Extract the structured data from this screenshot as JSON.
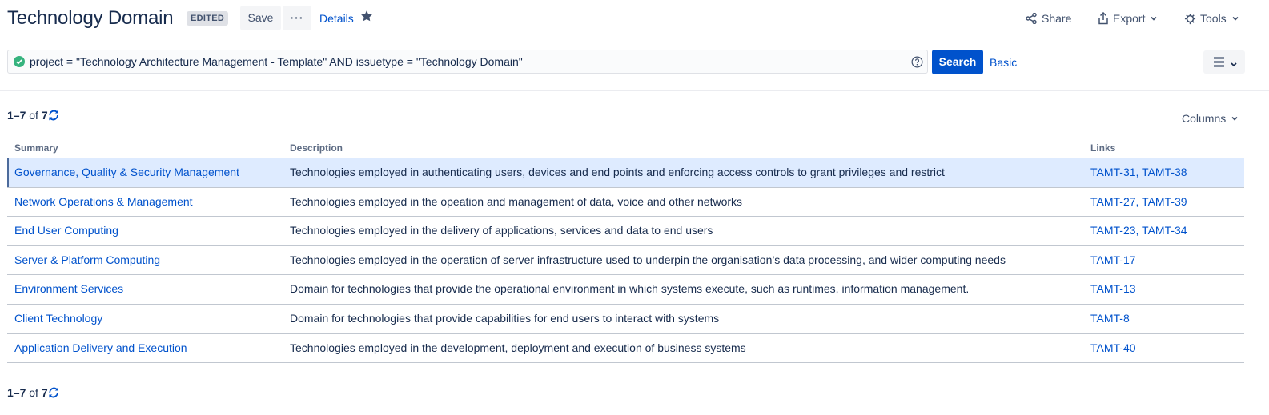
{
  "header": {
    "title": "Technology Domain",
    "badge": "EDITED",
    "save_label": "Save",
    "more_label": "···",
    "details_label": "Details",
    "share_label": "Share",
    "export_label": "Export",
    "tools_label": "Tools"
  },
  "search": {
    "query": "project = \"Technology Architecture Management - Template\" AND issuetype = \"Technology Domain\"",
    "search_label": "Search",
    "basic_label": "Basic"
  },
  "results": {
    "range": "1–7",
    "of_label": "of",
    "total": "7",
    "columns_label": "Columns",
    "headers": {
      "summary": "Summary",
      "description": "Description",
      "links": "Links"
    },
    "rows": [
      {
        "summary": "Governance, Quality & Security Management",
        "description": "Technologies employed in authenticating users, devices and end points and enforcing access controls to grant privileges and restrict",
        "links": "TAMT-31, TAMT-38"
      },
      {
        "summary": "Network Operations & Management",
        "description": "Technologies employed in the opeation and management of data, voice and other networks",
        "links": "TAMT-27, TAMT-39"
      },
      {
        "summary": "End User Computing",
        "description": "Technologies employed in the delivery of applications, services and data to end users",
        "links": "TAMT-23, TAMT-34"
      },
      {
        "summary": "Server & Platform Computing",
        "description": "Technologies employed in the operation of server infrastructure used to underpin the organisation’s data processing, and wider computing needs",
        "links": "TAMT-17"
      },
      {
        "summary": "Environment Services",
        "description": "Domain for technologies that provide the operational environment in which systems execute, such as runtimes, information management.",
        "links": "TAMT-13"
      },
      {
        "summary": "Client Technology",
        "description": "Domain for technologies that provide capabilities for end users to interact with systems",
        "links": "TAMT-8"
      },
      {
        "summary": "Application Delivery and Execution",
        "description": "Technologies employed in the development, deployment and execution of business systems",
        "links": "TAMT-40"
      }
    ]
  },
  "colors": {
    "primary": "#0052cc",
    "text": "#172b4d",
    "selected_row": "#deebff",
    "valid": "#36b37e"
  },
  "icons": [
    "star-icon",
    "share-icon",
    "export-icon",
    "chevron-down-icon",
    "gear-icon",
    "check-circle-icon",
    "help-icon",
    "list-view-icon",
    "refresh-icon"
  ]
}
